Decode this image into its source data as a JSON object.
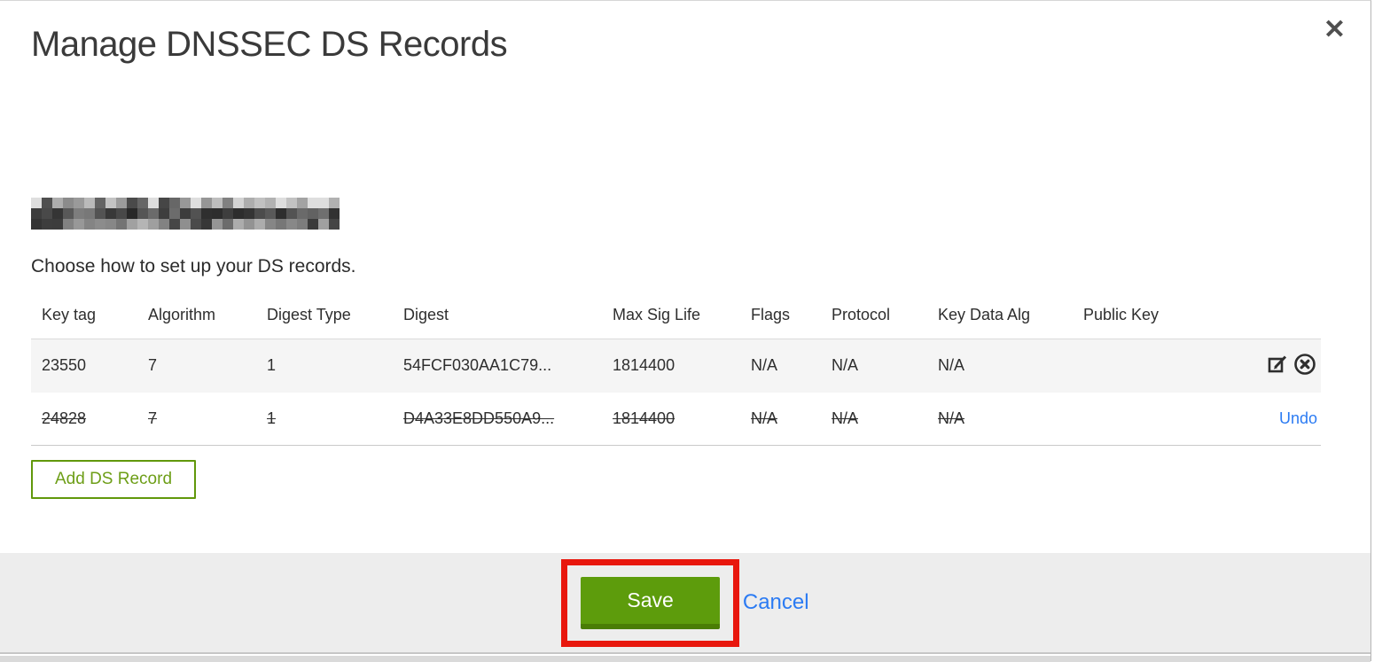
{
  "modal": {
    "title": "Manage DNSSEC DS Records",
    "close_label": "✕",
    "domain": {
      "redacted": true
    },
    "subtitle": "Choose how to set up your DS records.",
    "table": {
      "columns": [
        "Key tag",
        "Algorithm",
        "Digest Type",
        "Digest",
        "Max Sig Life",
        "Flags",
        "Protocol",
        "Key Data Alg",
        "Public Key"
      ],
      "rows": [
        {
          "key_tag": "23550",
          "algorithm": "7",
          "digest_type": "1",
          "digest": "54FCF030AA1C79...",
          "max_sig_life": "1814400",
          "flags": "N/A",
          "protocol": "N/A",
          "key_data_alg": "N/A",
          "public_key": "",
          "state": "normal",
          "actions": [
            "edit",
            "delete"
          ]
        },
        {
          "key_tag": "24828",
          "algorithm": "7",
          "digest_type": "1",
          "digest": "D4A33E8DD550A9...",
          "max_sig_life": "1814400",
          "flags": "N/A",
          "protocol": "N/A",
          "key_data_alg": "N/A",
          "public_key": "",
          "state": "deleted",
          "actions": [
            "undo"
          ],
          "undo_label": "Undo"
        }
      ]
    },
    "add_button_label": "Add DS Record",
    "footer": {
      "save_label": "Save",
      "cancel_label": "Cancel",
      "annotation": "red-highlight-around-save"
    }
  },
  "colors": {
    "accent_green": "#5d9c0c",
    "accent_green_dark": "#4a7d05",
    "outline_green": "#61980b",
    "outline_green_text": "#6d9e17",
    "annotation_red": "#e8170d",
    "link_blue": "#2b7bf3",
    "footer_gray": "#ededed"
  }
}
